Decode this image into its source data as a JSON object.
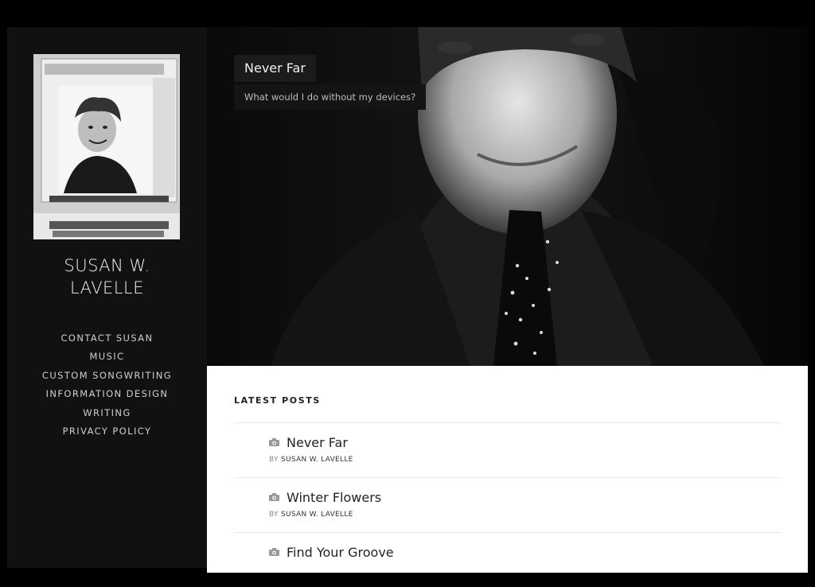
{
  "site": {
    "title_line1": "SUSAN W.",
    "title_line2": "LAVELLE"
  },
  "nav": {
    "items": [
      {
        "label": "CONTACT SUSAN"
      },
      {
        "label": "MUSIC"
      },
      {
        "label": "CUSTOM SONGWRITING"
      },
      {
        "label": "INFORMATION DESIGN"
      },
      {
        "label": "WRITING"
      },
      {
        "label": "PRIVACY POLICY"
      }
    ]
  },
  "hero": {
    "title": "Never Far",
    "subtitle": "What would I do without my devices?"
  },
  "latest": {
    "heading": "LATEST POSTS",
    "by_label": "BY",
    "posts": [
      {
        "title": "Never Far",
        "author": "SUSAN W. LAVELLE"
      },
      {
        "title": "Winter Flowers",
        "author": "SUSAN W. LAVELLE"
      },
      {
        "title": "Find Your Groove",
        "author": ""
      }
    ]
  },
  "colors": {
    "background": "#000000",
    "sidebar": "#111111",
    "content": "#ffffff"
  },
  "icons": {
    "post_format": "camera-icon"
  }
}
